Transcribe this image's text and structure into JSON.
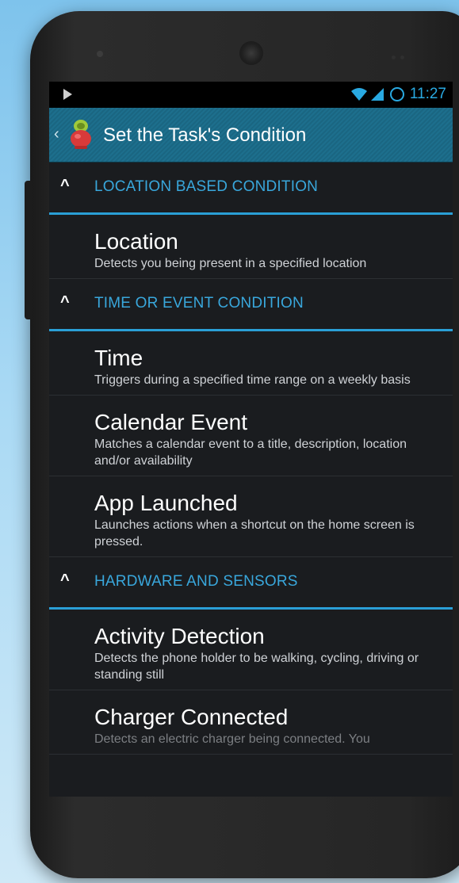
{
  "status_bar": {
    "time": "11:27"
  },
  "action_bar": {
    "back_glyph": "‹",
    "title": "Set the Task's Condition"
  },
  "sections": [
    {
      "header": "LOCATION BASED CONDITION",
      "items": [
        {
          "title": "Location",
          "desc": "Detects you being present in a specified location"
        }
      ]
    },
    {
      "header": "TIME OR EVENT CONDITION",
      "items": [
        {
          "title": "Time",
          "desc": "Triggers during a specified time range on a weekly basis"
        },
        {
          "title": "Calendar Event",
          "desc": "Matches a calendar event to a title, description, location and/or availability"
        },
        {
          "title": "App Launched",
          "desc": "Launches actions when a shortcut on the home screen is pressed."
        }
      ]
    },
    {
      "header": "HARDWARE AND SENSORS",
      "items": [
        {
          "title": "Activity Detection",
          "desc": "Detects the phone holder to be walking, cycling, driving or standing still"
        },
        {
          "title": "Charger Connected",
          "desc": "Detects an electric charger being connected. You"
        }
      ]
    }
  ],
  "icons": {
    "play": "play-icon",
    "wifi": "wifi-icon",
    "signal": "signal-icon",
    "battery": "battery-ring-icon",
    "collapse": "chevron-up-icon",
    "app_logo": "app-logo-icon"
  },
  "colors": {
    "accent": "#29a9e1",
    "action_bar": "#1d6f8d",
    "screen_bg": "#1a1c1f",
    "section_label": "#39a7dc"
  }
}
